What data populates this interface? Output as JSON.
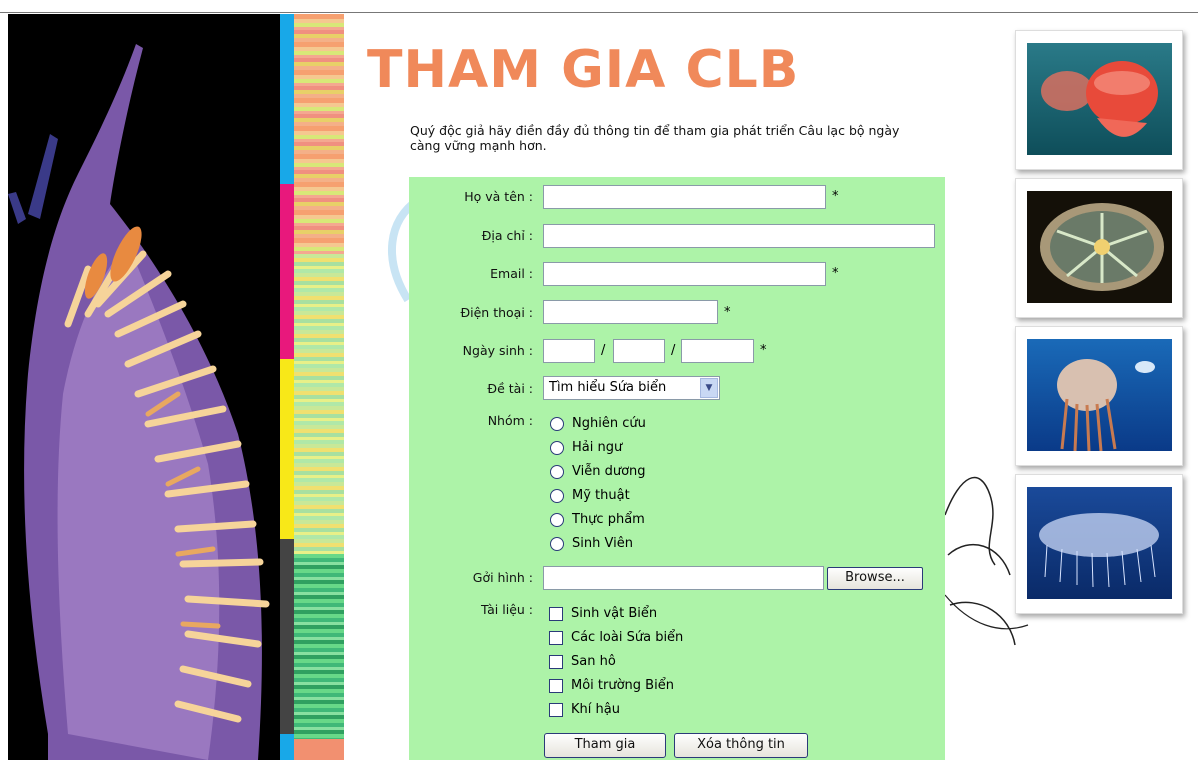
{
  "page": {
    "title": "THAM GIA CLB",
    "intro": "Quý độc giả hãy điền đầy đủ thông tin để tham gia phát triển Câu lạc bộ ngày càng vững mạnh hơn."
  },
  "form": {
    "fields": {
      "fullname": {
        "label": "Họ và tên :",
        "value": "",
        "required": "*"
      },
      "address": {
        "label": "Địa chỉ :",
        "value": ""
      },
      "email": {
        "label": "Email :",
        "value": "",
        "required": "*"
      },
      "phone": {
        "label": "Điện thoại :",
        "value": "",
        "required": "*"
      },
      "birthday": {
        "label": "Ngày sinh :",
        "separator": "/",
        "required": "*"
      },
      "topic": {
        "label": "Đề tài :",
        "selected": "Tìm hiểu Sứa biển"
      },
      "group": {
        "label": "Nhóm :",
        "options": [
          "Nghiên cứu",
          "Hải ngư",
          "Viễn dương",
          "Mỹ thuật",
          "Thực phẩm",
          "Sinh Viên"
        ]
      },
      "photo": {
        "label": "Gởi hình :",
        "browse": "Browse..."
      },
      "documents": {
        "label": "Tài liệu :",
        "options": [
          "Sinh vật Biển",
          "Các loài Sứa biển",
          "San hô",
          "Môi trường Biển",
          "Khí hậu"
        ]
      }
    },
    "buttons": {
      "submit": "Tham gia",
      "reset": "Xóa thông tin"
    }
  },
  "colors": {
    "title": "#f0895a",
    "form_bg": "#adf3a8"
  }
}
